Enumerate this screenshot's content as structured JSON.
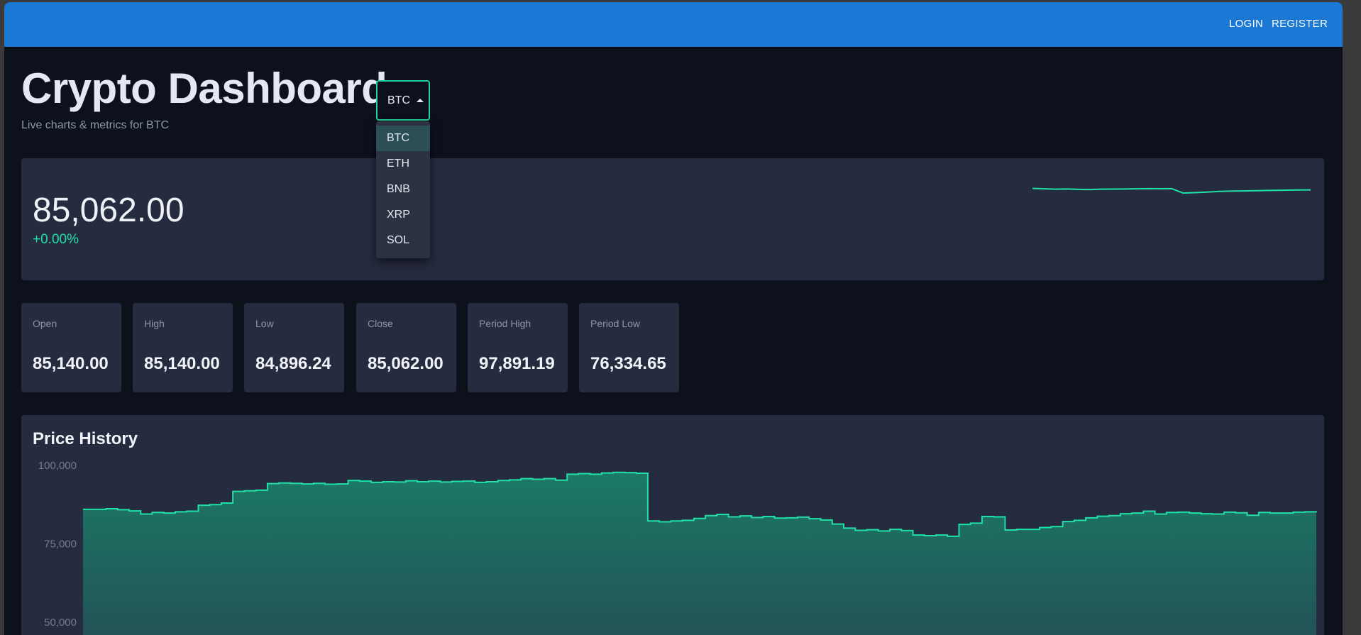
{
  "topbar": {
    "login_label": "LOGIN",
    "register_label": "REGISTER",
    "background": "#1b78d4"
  },
  "header": {
    "title": "Crypto Dashboard",
    "subtitle": "Live charts & metrics for BTC"
  },
  "coin_select": {
    "value": "BTC",
    "options": [
      "BTC",
      "ETH",
      "BNB",
      "XRP",
      "SOL"
    ],
    "selected_index": 0,
    "accent": "#1fd1a0"
  },
  "price": {
    "value": "85,062.00",
    "change": "+0.00%",
    "change_color": "#1fe0a6"
  },
  "metrics": [
    {
      "label": "Open",
      "value": "85,140.00"
    },
    {
      "label": "High",
      "value": "85,140.00"
    },
    {
      "label": "Low",
      "value": "84,896.24"
    },
    {
      "label": "Close",
      "value": "85,062.00"
    },
    {
      "label": "Period High",
      "value": "97,891.19"
    },
    {
      "label": "Period Low",
      "value": "76,334.65"
    }
  ],
  "history": {
    "title": "Price History"
  },
  "chart_data": {
    "type": "area",
    "title": "Price History",
    "xlabel": "",
    "ylabel": "",
    "y_ticks": [
      "100,000",
      "75,000",
      "50,000"
    ],
    "y_tick_values": [
      100000,
      75000,
      50000
    ],
    "ylim": [
      46000,
      100000
    ],
    "grid": false,
    "line_color": "#1fe0a6",
    "fill_top": "#1b7a65",
    "fill_bottom": "#234f56",
    "series": [
      {
        "values": [
          86000,
          86000,
          86200,
          85900,
          85500,
          84500,
          85000,
          84800,
          85200,
          85400,
          87300,
          87500,
          88000,
          91700,
          91900,
          92100,
          94200,
          94400,
          94300,
          94100,
          94300,
          94000,
          94100,
          95200,
          95000,
          94600,
          94800,
          94700,
          95100,
          94800,
          95000,
          94700,
          94900,
          95000,
          94600,
          94800,
          95200,
          95400,
          95800,
          95600,
          95800,
          95300,
          97200,
          97400,
          97200,
          97600,
          97800,
          97700,
          97500,
          82300,
          82000,
          82300,
          82500,
          83100,
          84000,
          84400,
          83600,
          83900,
          83400,
          83700,
          83200,
          83300,
          83500,
          83000,
          82600,
          81300,
          80000,
          79300,
          79500,
          79100,
          79600,
          79200,
          77800,
          77600,
          77800,
          77400,
          81200,
          81600,
          83700,
          83600,
          79400,
          79600,
          79600,
          80200,
          80500,
          82100,
          82500,
          83300,
          83800,
          84000,
          84600,
          84800,
          85400,
          84500,
          85000,
          85100,
          84800,
          84600,
          84500,
          85100,
          84900,
          84100,
          85000,
          84800,
          84800,
          85100,
          85200,
          85000
        ]
      }
    ]
  },
  "sparkline": {
    "color": "#1fe0a6",
    "values": [
      85140,
      85120,
      85100,
      85110,
      85090,
      85080,
      85100,
      85105,
      85110,
      85120,
      85130,
      85125,
      85130,
      84900,
      84920,
      84950,
      84980,
      85000,
      85010,
      85020,
      85030,
      85040,
      85050,
      85060,
      85062
    ]
  }
}
